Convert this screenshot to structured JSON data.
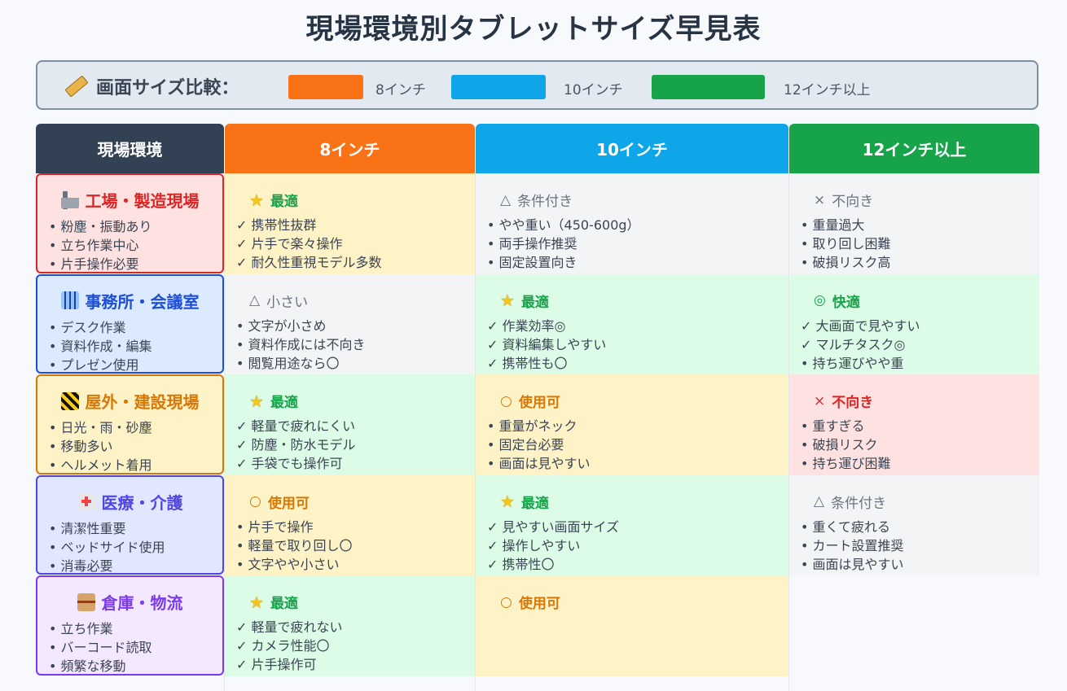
{
  "title": "現場環境別タブレットサイズ早見表",
  "legend": {
    "label": "画面サイズ比較：",
    "items": [
      {
        "label": "8インチ",
        "color": "#f97316"
      },
      {
        "label": "10インチ",
        "color": "#0ea5e9"
      },
      {
        "label": "12インチ以上",
        "color": "#16a34a"
      }
    ]
  },
  "headers": {
    "env": "現場環境",
    "c8": "8インチ",
    "c10": "10インチ",
    "c12": "12インチ以上"
  },
  "rows": [
    {
      "env": {
        "title": "工場・製造現場",
        "icon": "factory-icon",
        "color": "#dc2626",
        "bg": "#fee2e2",
        "items": [
          "• 粉塵・振動あり",
          "• 立ち作業中心",
          "• 片手操作必要"
        ]
      },
      "c8": {
        "title": "最適",
        "mark": "☆",
        "tone": "green",
        "items": [
          "✓ 携帯性抜群",
          "✓ 片手で楽々操作",
          "✓ 耐久性重視モデル多数"
        ]
      },
      "c10": {
        "title": "条件付き",
        "mark": "△",
        "tone": "gray",
        "items": [
          "• やや重い（450-600g）",
          "• 両手操作推奨",
          "• 固定設置向き"
        ]
      },
      "c12": {
        "title": "不向き",
        "mark": "×",
        "tone": "gray",
        "items": [
          "• 重量過大",
          "• 取り回し困難",
          "• 破損リスク高"
        ]
      }
    },
    {
      "env": {
        "title": "事務所・会議室",
        "icon": "office-building-icon",
        "color": "#1d4ed8",
        "bg": "#dbeafe",
        "items": [
          "• デスク作業",
          "• 資料作成・編集",
          "• プレゼン使用"
        ]
      },
      "c8": {
        "title": "小さい",
        "mark": "△",
        "tone": "gray",
        "items": [
          "• 文字が小さめ",
          "• 資料作成には不向き",
          "• 閲覧用途なら〇"
        ]
      },
      "c10": {
        "title": "最適",
        "mark": "☆",
        "tone": "green",
        "items": [
          "✓ 作業効率◎",
          "✓ 資料編集しやすい",
          "✓ 携帯性も〇"
        ]
      },
      "c12": {
        "title": "快適",
        "mark": "◎",
        "tone": "green",
        "items": [
          "✓ 大画面で見やすい",
          "✓ マルチタスク◎",
          "• 持ち運びやや重"
        ]
      }
    },
    {
      "env": {
        "title": "屋外・建設現場",
        "icon": "construction-barrier-icon",
        "color": "#d97706",
        "bg": "#fef3c7",
        "items": [
          "• 日光・雨・砂塵",
          "• 移動多い",
          "• ヘルメット着用"
        ]
      },
      "c8": {
        "title": "最適",
        "mark": "☆",
        "tone": "green",
        "items": [
          "✓ 軽量で疲れにくい",
          "✓ 防塵・防水モデル",
          "✓ 手袋でも操作可"
        ]
      },
      "c10": {
        "title": "使用可",
        "mark": "○",
        "tone": "yellow",
        "items": [
          "• 重量がネック",
          "• 固定台必要",
          "• 画面は見やすい"
        ]
      },
      "c12": {
        "title": "不向き",
        "mark": "×",
        "tone": "red",
        "items": [
          "• 重すぎる",
          "• 破損リスク",
          "• 持ち運び困難"
        ]
      }
    },
    {
      "env": {
        "title": "医療・介護",
        "icon": "hospital-icon",
        "color": "#4f46e5",
        "bg": "#e0e7ff",
        "items": [
          "• 清潔性重要",
          "• ベッドサイド使用",
          "• 消毒必要"
        ]
      },
      "c8": {
        "title": "使用可",
        "mark": "○",
        "tone": "yellow",
        "items": [
          "• 片手で操作",
          "• 軽量で取り回し〇",
          "• 文字やや小さい"
        ]
      },
      "c10": {
        "title": "最適",
        "mark": "☆",
        "tone": "green",
        "items": [
          "✓ 見やすい画面サイズ",
          "✓ 操作しやすい",
          "✓ 携帯性〇"
        ]
      },
      "c12": {
        "title": "条件付き",
        "mark": "△",
        "tone": "gray",
        "items": [
          "• 重くて疲れる",
          "• カート設置推奨",
          "• 画面は見やすい"
        ]
      }
    },
    {
      "env": {
        "title": "倉庫・物流",
        "icon": "package-icon",
        "color": "#7c3aed",
        "bg": "#f3e8ff",
        "items": [
          "• 立ち作業",
          "• バーコード読取",
          "• 頻繁な移動"
        ]
      },
      "c8": {
        "title": "最適",
        "mark": "☆",
        "tone": "green",
        "items": [
          "✓ 軽量で疲れない",
          "✓ カメラ性能〇",
          "✓ 片手操作可"
        ]
      },
      "c10": {
        "title": "使用可",
        "mark": "○",
        "tone": "yellow",
        "items": []
      },
      "c12": null
    }
  ],
  "colors": {
    "header_env": "#334155",
    "header_8": "#f97316",
    "header_10": "#0ea5e9",
    "header_12": "#16a34a",
    "tone_green_text": "#16a34a",
    "tone_gray_text": "#6b7280",
    "tone_yellow_text": "#d97706",
    "tone_red_text": "#dc2626"
  }
}
